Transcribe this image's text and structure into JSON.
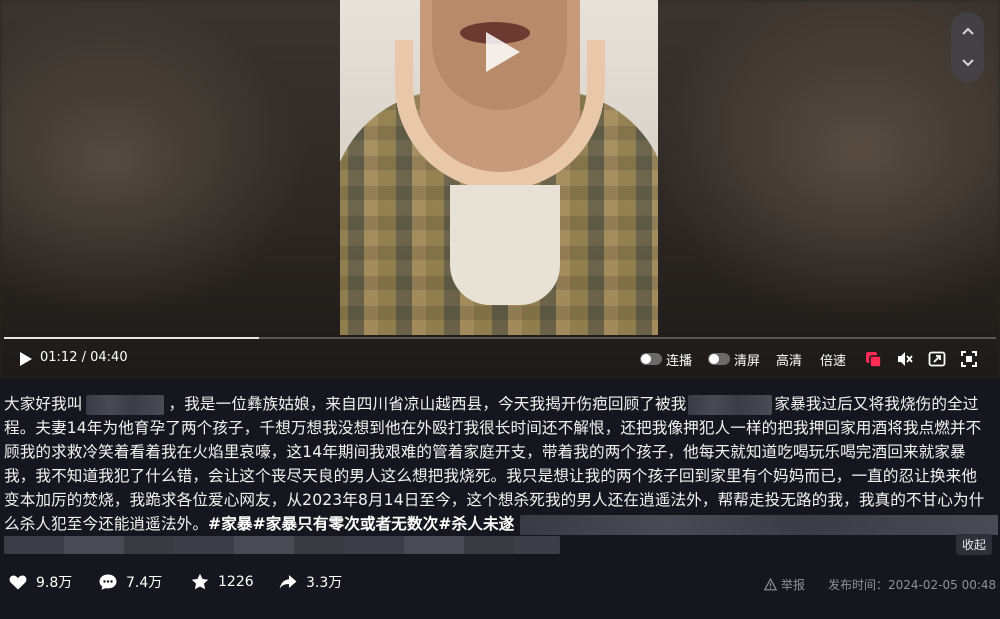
{
  "player": {
    "current_time": "01:12",
    "duration": "04:40",
    "time_separator": " / ",
    "progress_fraction": 0.257,
    "controls": {
      "autoplay_label": "连播",
      "clearscreen_label": "清屏",
      "quality_label": "高清",
      "speed_label": "倍速"
    }
  },
  "description": {
    "lines": [
      [
        "大家好我叫",
        "",
        "，我是一位彝族姑娘，来自四川省凉山越西县，今天我揭开伤疤回顾了被我",
        "",
        "家暴我过后又将我烧伤的全过"
      ],
      [
        "程。夫妻14年为他育孕了两个孩子，千想万想我没想到他在外殴打我很长时间还不解恨，还把我像押犯人一样的把我押回家用酒将我点燃并不"
      ],
      [
        "顾我的求救冷笑着看着我在火焰里哀嚎，这14年期间我艰难的管着家庭开支，带着我的两个孩子，他每天就知道吃喝玩乐喝完酒回来就家暴"
      ],
      [
        "我，我不知道我犯了什么错，会让这个丧尽天良的男人这么想把我烧死。我只是想让我的两个孩子回到家里有个妈妈而已，一直的忍让换来他"
      ],
      [
        "变本加厉的焚烧，我跪求各位爱心网友，从2023年8月14日至今，这个想杀死我的男人还在逍遥法外，帮帮走投无路的我，我真的不甘心为什"
      ],
      [
        "么杀人犯至今还能逍遥法外。"
      ]
    ],
    "tags": [
      "#家暴",
      "#家暴只有零次或者无数次",
      "#杀人未遂"
    ],
    "collapse_label": "收起"
  },
  "actions": {
    "likes": "9.8万",
    "comments": "7.4万",
    "favorites": "1226",
    "shares": "3.3万",
    "report_label": "举报",
    "publish_label": "发布时间：",
    "publish_time": "2024-02-05 00:48"
  },
  "icons": {
    "play": "play-icon",
    "nav_up": "chevron-up-icon",
    "nav_down": "chevron-down-icon",
    "danmaku": "danmaku-icon",
    "volume": "mute-icon",
    "pip": "picture-in-picture-icon",
    "fullscreen": "fullscreen-icon",
    "like": "heart-icon",
    "comment": "comment-icon",
    "favorite": "star-icon",
    "share": "share-icon",
    "report": "warning-icon"
  },
  "colors": {
    "background": "#16161e",
    "accent_red": "#fe2c55",
    "muted_text": "#8f8f99"
  }
}
